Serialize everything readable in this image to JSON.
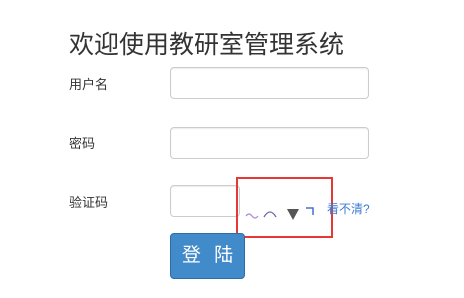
{
  "title": "欢迎使用教研室管理系统",
  "form": {
    "username_label": "用户名",
    "username_value": "",
    "password_label": "密码",
    "password_value": "",
    "captcha_label": "验证码",
    "captcha_value": "",
    "captcha_refresh_link": "看不清?",
    "submit_label": "登 陆"
  },
  "colors": {
    "button_bg": "#428bca",
    "link": "#3a7bd5",
    "highlight_border": "#e53935"
  }
}
